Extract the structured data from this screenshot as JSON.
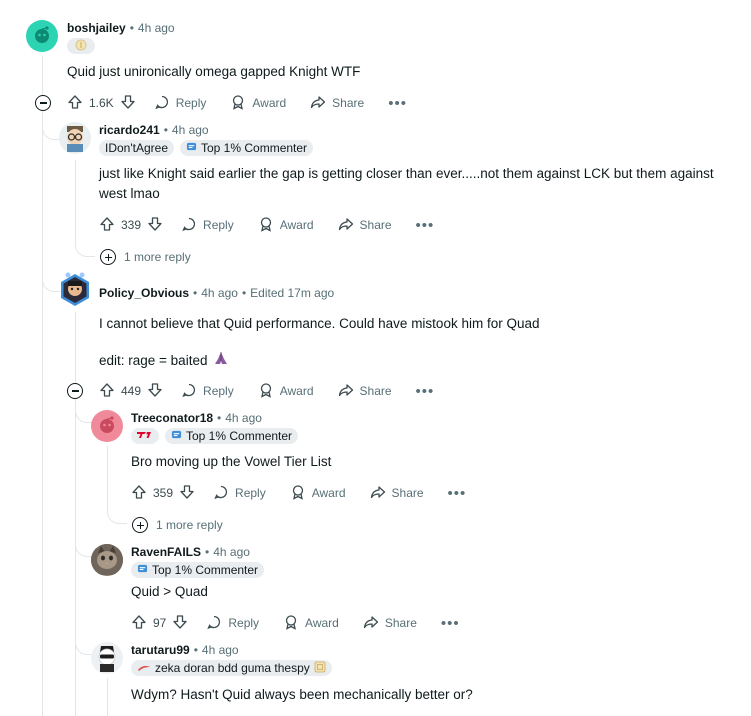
{
  "action_labels": {
    "reply": "Reply",
    "award": "Award",
    "share": "Share",
    "more_replies": "1 more reply"
  },
  "colors": {
    "meta_text": "#576f76",
    "thread_line": "#e3e6e8",
    "pill_bg": "#eaedef",
    "text": "#0f1a1c"
  },
  "comments": [
    {
      "user": "boshjailey",
      "time": "4h ago",
      "text": "Quid just unironically omega gapped Knight WTF",
      "votes": "1.6K",
      "avatar_icon": "snoo-avatar-icon"
    },
    {
      "user": "ricardo241",
      "time": "4h ago",
      "flairs": [
        "IDon'tAgree",
        "Top 1% Commenter"
      ],
      "text": "just like Knight said earlier the gap is getting closer than ever.....not them against LCK but them against west lmao",
      "votes": "339",
      "avatar_icon": "glasses-avatar-icon"
    },
    {
      "user": "Policy_Obvious",
      "time": "4h ago",
      "edited": "Edited 17m ago",
      "text": "I cannot believe that Quid performance. Could have mistook him for Quad",
      "text2": "edit: rage = baited",
      "votes": "449",
      "avatar_icon": "hex-avatar-icon"
    },
    {
      "user": "Treeconator18",
      "time": "4h ago",
      "flairs": [
        "Top 1% Commenter"
      ],
      "text": "Bro moving up the Vowel Tier List",
      "votes": "359",
      "avatar_icon": "snoo-avatar-icon"
    },
    {
      "user": "RavenFAILS",
      "time": "4h ago",
      "flairs": [
        "Top 1% Commenter"
      ],
      "text": "Quid > Quad",
      "votes": "97",
      "avatar_icon": "cat-avatar-icon"
    },
    {
      "user": "tarutaru99",
      "time": "4h ago",
      "flairs": [
        "zeka doran bdd guma thespy"
      ],
      "text": "Wdym? Hasn't Quid always been mechanically better or?",
      "avatar_icon": "sunglasses-avatar-icon"
    }
  ]
}
